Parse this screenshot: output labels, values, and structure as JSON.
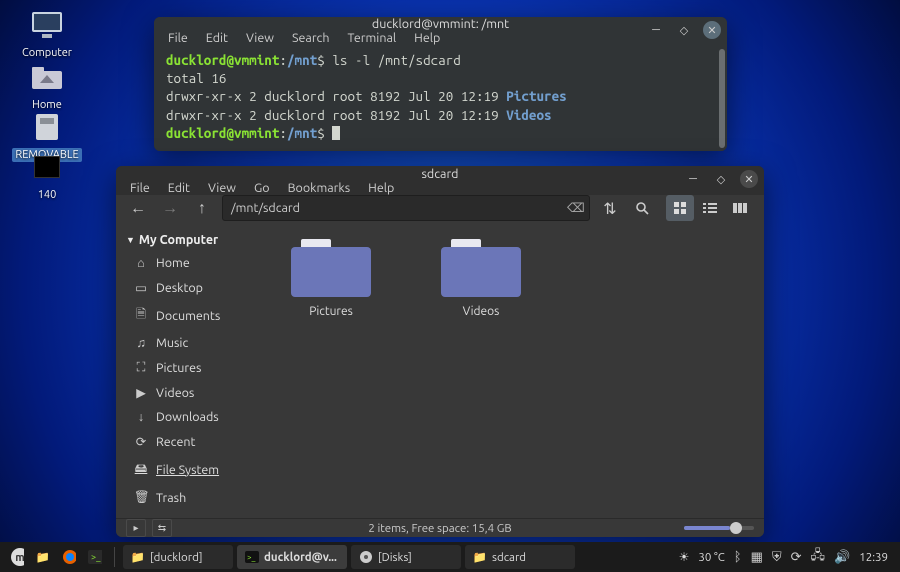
{
  "desktop": {
    "icons": [
      {
        "name": "computer",
        "label": "Computer"
      },
      {
        "name": "home",
        "label": "Home"
      },
      {
        "name": "removable",
        "label": "REMOVABLE"
      },
      {
        "name": "140",
        "label": "140"
      }
    ]
  },
  "terminal": {
    "title": "ducklord@vmmint: /mnt",
    "menu": [
      "File",
      "Edit",
      "View",
      "Search",
      "Terminal",
      "Help"
    ],
    "prompt_user": "ducklord@vmmint",
    "prompt_path": "/mnt",
    "command": "ls -l /mnt/sdcard",
    "output": {
      "total": "total 16",
      "rows": [
        {
          "perm": "drwxr-xr-x",
          "links": "2",
          "owner": "ducklord",
          "group": "root",
          "size": "8192",
          "date": "Jul 20 12:19",
          "name": "Pictures"
        },
        {
          "perm": "drwxr-xr-x",
          "links": "2",
          "owner": "ducklord",
          "group": "root",
          "size": "8192",
          "date": "Jul 20 12:19",
          "name": "Videos"
        }
      ]
    }
  },
  "filemanager": {
    "title": "sdcard",
    "menu": [
      "File",
      "Edit",
      "View",
      "Go",
      "Bookmarks",
      "Help"
    ],
    "path": "/mnt/sdcard",
    "sidebar_header": "My Computer",
    "sidebar": [
      {
        "icon": "home",
        "label": "Home"
      },
      {
        "icon": "desktop",
        "label": "Desktop"
      },
      {
        "icon": "documents",
        "label": "Documents"
      },
      {
        "icon": "music",
        "label": "Music"
      },
      {
        "icon": "pictures",
        "label": "Pictures"
      },
      {
        "icon": "videos",
        "label": "Videos"
      },
      {
        "icon": "downloads",
        "label": "Downloads"
      },
      {
        "icon": "recent",
        "label": "Recent"
      },
      {
        "icon": "filesystem",
        "label": "File System",
        "active": true
      },
      {
        "icon": "trash",
        "label": "Trash"
      }
    ],
    "items": [
      {
        "name": "Pictures"
      },
      {
        "name": "Videos"
      }
    ],
    "status": "2 items, Free space: 15,4 GB"
  },
  "taskbar": {
    "apps": [
      {
        "icon": "mint",
        "label": ""
      },
      {
        "icon": "files",
        "label": ""
      },
      {
        "icon": "firefox",
        "label": ""
      },
      {
        "icon": "terminal",
        "label": ""
      }
    ],
    "windows": [
      {
        "icon": "files",
        "label": "[ducklord]"
      },
      {
        "icon": "terminal",
        "label": "ducklord@v...",
        "active": true
      },
      {
        "icon": "disks",
        "label": "[Disks]"
      },
      {
        "icon": "files",
        "label": "sdcard"
      }
    ],
    "temp": "30 °C",
    "clock": "12:39"
  }
}
